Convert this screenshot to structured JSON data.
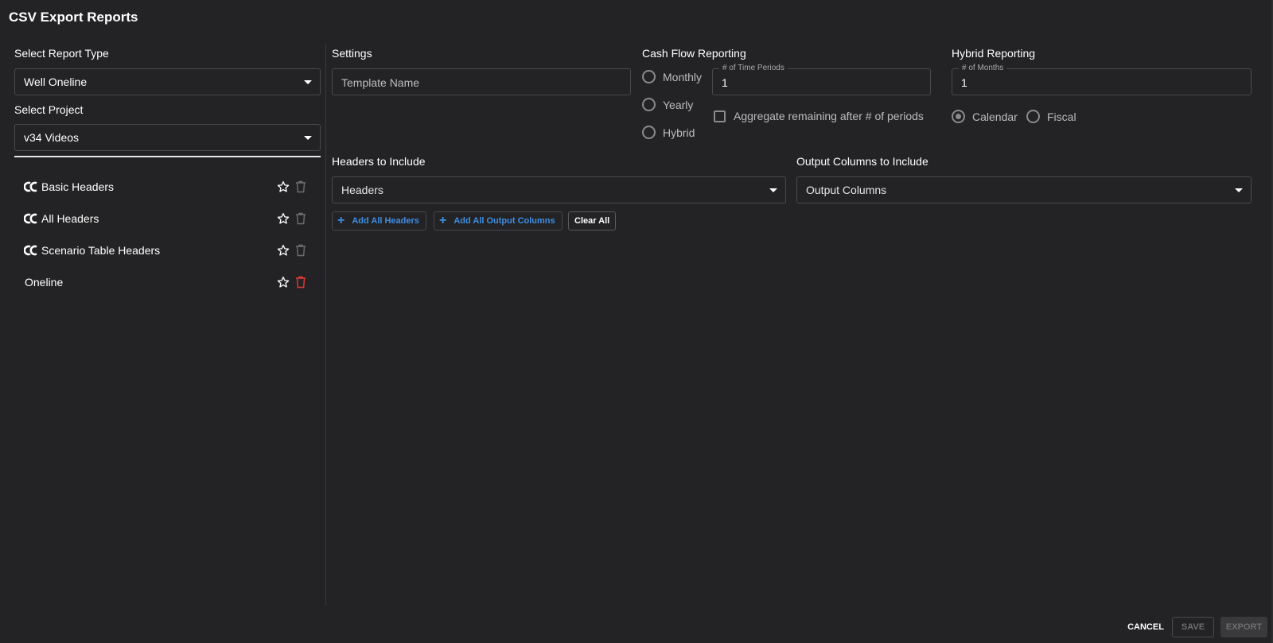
{
  "page": {
    "title": "CSV Export Reports"
  },
  "left": {
    "report_type_label": "Select Report Type",
    "report_type_value": "Well Oneline",
    "project_label": "Select Project",
    "project_value": "v34 Videos",
    "templates": [
      {
        "name": "Basic Headers",
        "builtin": true,
        "deletable": false
      },
      {
        "name": "All Headers",
        "builtin": true,
        "deletable": false
      },
      {
        "name": "Scenario Table Headers",
        "builtin": true,
        "deletable": false
      },
      {
        "name": "Oneline",
        "builtin": false,
        "deletable": true
      }
    ]
  },
  "settings": {
    "label": "Settings",
    "template_name_placeholder": "Template Name"
  },
  "cash_flow": {
    "label": "Cash Flow Reporting",
    "options": [
      "Monthly",
      "Yearly",
      "Hybrid"
    ],
    "time_periods_label": "# of Time Periods",
    "time_periods_value": "1",
    "aggregate_label": "Aggregate remaining after # of periods"
  },
  "hybrid": {
    "label": "Hybrid Reporting",
    "months_label": "# of Months",
    "months_value": "1",
    "calendar_label": "Calendar",
    "fiscal_label": "Fiscal",
    "selected": "Calendar"
  },
  "headers": {
    "label": "Headers to Include",
    "select_value": "Headers"
  },
  "output_columns": {
    "label": "Output Columns to Include",
    "select_value": "Output Columns"
  },
  "actions": {
    "add_all_headers": "Add All Headers",
    "add_all_output_columns": "Add All Output Columns",
    "clear_all": "Clear All"
  },
  "footer": {
    "cancel": "CANCEL",
    "save": "SAVE",
    "export": "EXPORT"
  },
  "colors": {
    "background": "#232325",
    "accent": "#3f8ee3",
    "delete_active": "#e53935"
  },
  "icons": {
    "builtin": "cc-logo-icon",
    "favorite": "star-outline-icon",
    "delete": "trash-icon",
    "dropdown": "caret-down-icon",
    "add": "plus-icon"
  }
}
